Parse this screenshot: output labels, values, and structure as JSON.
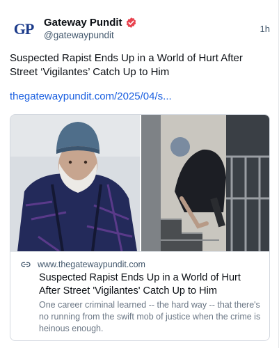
{
  "post": {
    "author": {
      "display_name": "Gateway Pundit",
      "handle": "@gatewaypundit",
      "avatar_text": "GP",
      "verified_icon": "verified-badge-icon"
    },
    "time": "1h",
    "text": "Suspected Rapist Ends Up in a World of Hurt After Street ‘Vigilantes’ Catch Up to Him",
    "link_text": "thegatewaypundit.com/2025/04/s..."
  },
  "card": {
    "domain": "www.thegatewaypundit.com",
    "title": "Suspected Rapist Ends Up in a World of Hurt After Street 'Vigilantes' Catch Up to Him",
    "description": "One career criminal learned -- the hard way -- that there's no running from the swift mob of justice when the crime is heinous enough.",
    "icon": "link-icon"
  },
  "colors": {
    "link": "#1a5fe0",
    "verified": "#e8434f",
    "muted": "#42576c"
  }
}
